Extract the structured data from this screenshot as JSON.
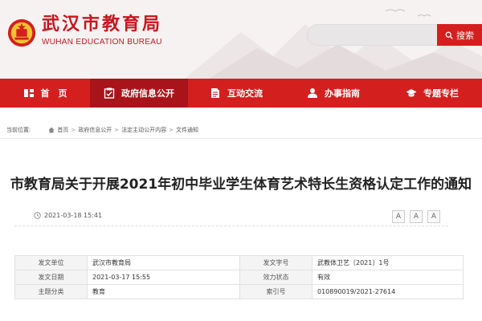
{
  "header": {
    "title_cn": "武汉市教育局",
    "title_en": "WUHAN EDUCATION BUREAU",
    "brand_color": "#c9151e",
    "emblem_icon": "national-emblem-icon"
  },
  "search": {
    "placeholder": "",
    "button_label": "搜索",
    "icon": "search-icon"
  },
  "nav": {
    "items": [
      {
        "label": "首　页",
        "icon": "home-icon"
      },
      {
        "label": "政府信息公开",
        "icon": "checklist-icon",
        "active": true
      },
      {
        "label": "互动交流",
        "icon": "document-icon"
      },
      {
        "label": "办事指南",
        "icon": "person-icon"
      },
      {
        "label": "专题专栏",
        "icon": "graduation-cap-icon"
      }
    ],
    "color": "#d41f1f",
    "active_color": "#a8141a"
  },
  "breadcrumb": {
    "prefix": "当前位置:",
    "items": [
      "首页",
      "政府信息公开",
      "法定主动公开内容",
      "文件通知"
    ],
    "separator": ">"
  },
  "article": {
    "title": "市教育局关于开展2021年初中毕业学生体育艺术特长生资格认定工作的通知",
    "publish_time": "2021-03-18 15:41",
    "font_buttons": [
      "A",
      "A",
      "A"
    ]
  },
  "info": {
    "rows": [
      {
        "l1": "发文单位",
        "v1": "武汉市教育局",
        "l2": "发文字号",
        "v2": "武教体卫艺〔2021〕1号"
      },
      {
        "l1": "发文日期",
        "v1": "2021-03-17 15:55",
        "l2": "效力状态",
        "v2": "有效"
      },
      {
        "l1": "主题分类",
        "v1": "教育",
        "l2": "索引号",
        "v2": "010890019/2021-27614"
      }
    ]
  }
}
